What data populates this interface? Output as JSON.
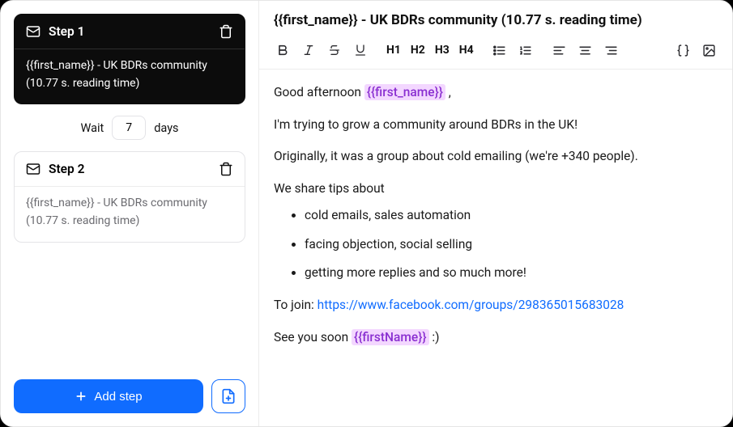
{
  "sidebar": {
    "steps": [
      {
        "title": "Step 1",
        "subject": "{{first_name}} - UK BDRs community (10.77 s. reading time)",
        "active": true
      },
      {
        "title": "Step 2",
        "subject": "{{first_name}} - UK BDRs community (10.77 s. reading time)",
        "active": false
      }
    ],
    "wait": {
      "prefix": "Wait",
      "value": "7",
      "suffix": "days"
    },
    "add_step_label": "Add step"
  },
  "editor": {
    "subject": "{{first_name}} - UK BDRs community (10.77 s. reading time)",
    "toolbar": {
      "headings": [
        "H1",
        "H2",
        "H3",
        "H4"
      ]
    },
    "body": {
      "greeting_pre": "Good afternoon ",
      "greeting_tag": "{{first_name}}",
      "greeting_post": " ,",
      "p1": "I'm trying to grow a community around BDRs in the UK!",
      "p2": "Originally, it was a group about cold emailing (we're +340 people).",
      "p3": "We share tips about",
      "bullets": [
        "cold emails, sales automation",
        "facing objection, social selling",
        "getting more replies and so much more!"
      ],
      "join_pre": "To join: ",
      "join_link": "https://www.facebook.com/groups/298365015683028",
      "closing_pre": "See you soon ",
      "closing_tag": "{{firstName}}",
      "closing_post": " :)"
    }
  }
}
